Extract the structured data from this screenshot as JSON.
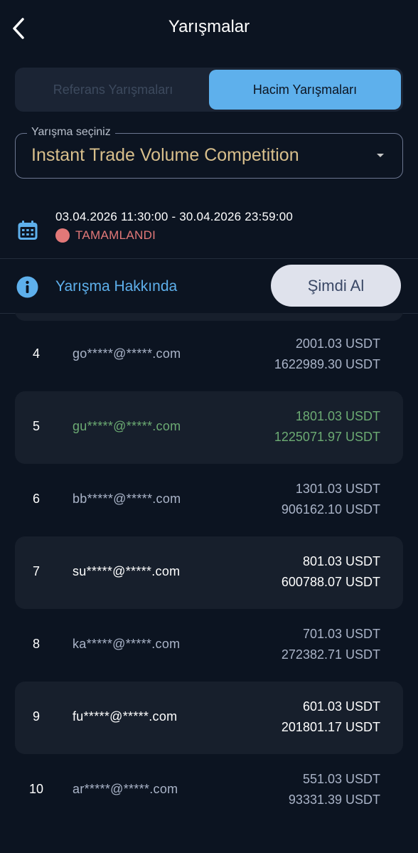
{
  "header": {
    "title": "Yarışmalar",
    "back_icon": "chevron-left-icon"
  },
  "tabs": [
    {
      "label": "Referans Yarışmaları",
      "active": false
    },
    {
      "label": "Hacim Yarışmaları",
      "active": true
    }
  ],
  "competition_select": {
    "label": "Yarışma seçiniz",
    "value": "Instant Trade Volume Competition",
    "icon": "caret-down-icon"
  },
  "period": {
    "date_range": "03.04.2026 11:30:00 - 30.04.2026 23:59:00",
    "status": "TAMAMLANDI",
    "icon": "calendar-icon",
    "status_color": "#e27878"
  },
  "info": {
    "link_label": "Yarışma Hakkında",
    "claim_button": "Şimdi Al",
    "icon": "info-icon"
  },
  "colors": {
    "accent": "#5eb0ec",
    "background": "#0c1421",
    "highlight": "#6cab73",
    "title_gold": "#d8bf8c"
  },
  "leaderboard": [
    {
      "rank": "4",
      "email": "go*****@*****.com",
      "prize": "2001.03 USDT",
      "volume": "1622989.30 USDT"
    },
    {
      "rank": "5",
      "email": "gu*****@*****.com",
      "prize": "1801.03 USDT",
      "volume": "1225071.97 USDT",
      "highlighted": true
    },
    {
      "rank": "6",
      "email": "bb*****@*****.com",
      "prize": "1301.03 USDT",
      "volume": "906162.10 USDT"
    },
    {
      "rank": "7",
      "email": "su*****@*****.com",
      "prize": "801.03 USDT",
      "volume": "600788.07 USDT"
    },
    {
      "rank": "8",
      "email": "ka*****@*****.com",
      "prize": "701.03 USDT",
      "volume": "272382.71 USDT"
    },
    {
      "rank": "9",
      "email": "fu*****@*****.com",
      "prize": "601.03 USDT",
      "volume": "201801.17 USDT"
    },
    {
      "rank": "10",
      "email": "ar*****@*****.com",
      "prize": "551.03 USDT",
      "volume": "93331.39 USDT"
    }
  ]
}
